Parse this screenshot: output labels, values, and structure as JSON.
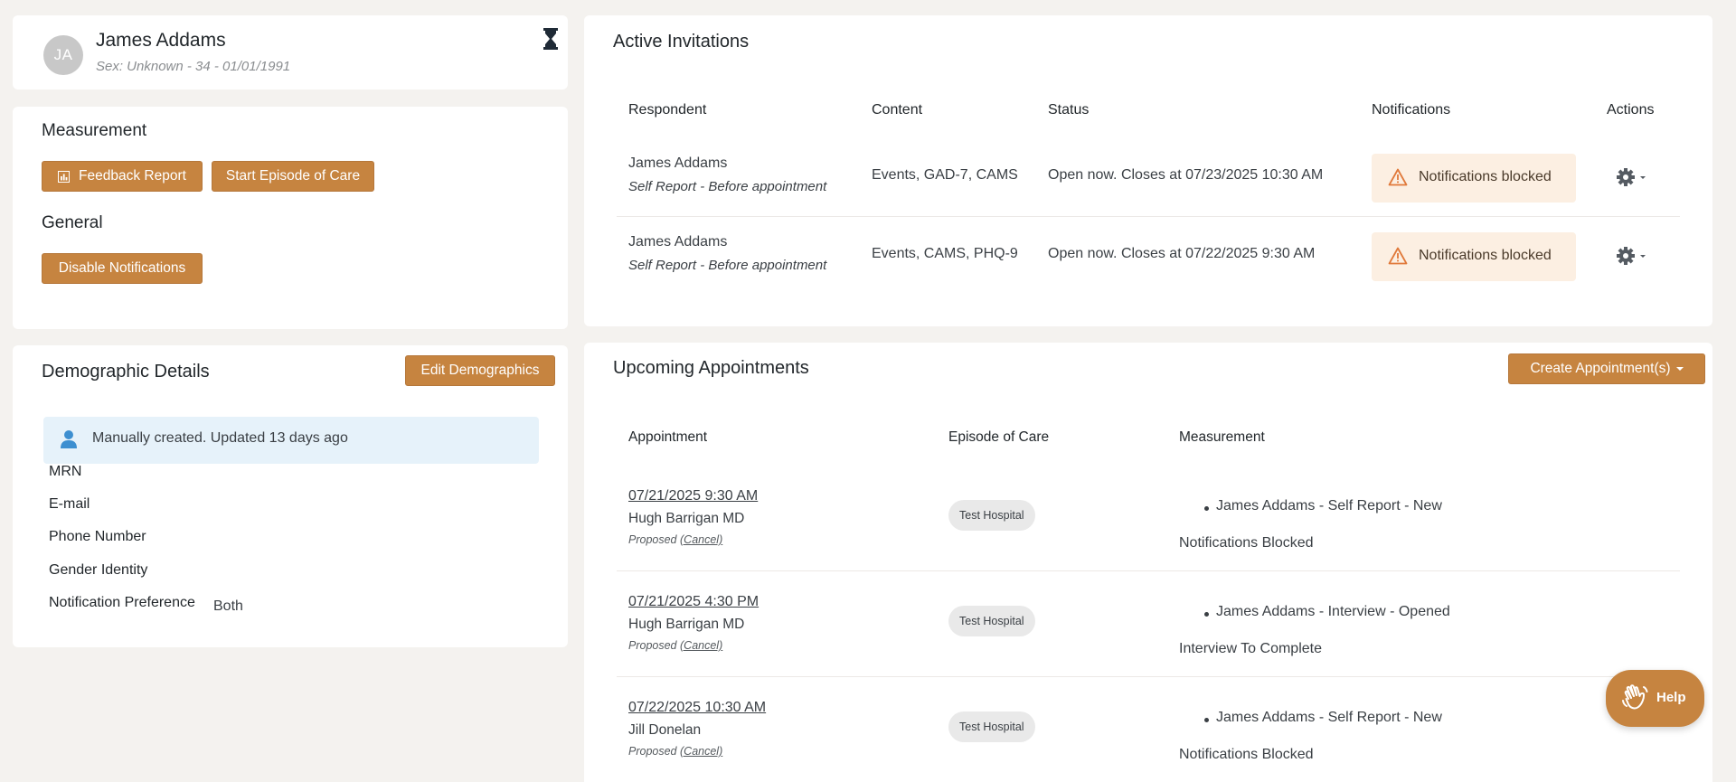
{
  "patient": {
    "initials": "JA",
    "name": "James Addams",
    "meta": "Sex: Unknown - 34 - 01/01/1991"
  },
  "actions_card": {
    "measurement_title": "Measurement",
    "feedback_report_label": "Feedback Report",
    "start_episode_label": "Start Episode of Care",
    "general_title": "General",
    "disable_notifications_label": "Disable Notifications"
  },
  "demographics": {
    "title": "Demographic Details",
    "edit_label": "Edit Demographics",
    "info_text": "Manually created. Updated 13 days ago",
    "fields": [
      {
        "label": "MRN",
        "value": ""
      },
      {
        "label": "E-mail",
        "value": ""
      },
      {
        "label": "Phone Number",
        "value": ""
      },
      {
        "label": "Gender Identity",
        "value": ""
      },
      {
        "label": "Notification Preference",
        "value": "Both"
      }
    ]
  },
  "invitations": {
    "title": "Active Invitations",
    "headers": [
      "Respondent",
      "Content",
      "Status",
      "Notifications",
      "Actions"
    ],
    "rows": [
      {
        "respondent": "James Addams",
        "type": "Self Report - Before appointment",
        "content": "Events, GAD-7, CAMS",
        "status": "Open now. Closes at 07/23/2025 10:30 AM",
        "notifications": "Notifications blocked"
      },
      {
        "respondent": "James Addams",
        "type": "Self Report - Before appointment",
        "content": "Events, CAMS, PHQ-9",
        "status": "Open now. Closes at 07/22/2025 9:30 AM",
        "notifications": "Notifications blocked"
      }
    ]
  },
  "appointments": {
    "title": "Upcoming Appointments",
    "create_label": "Create Appointment(s)",
    "headers": [
      "Appointment",
      "Episode of Care",
      "Measurement"
    ],
    "rows": [
      {
        "datetime": "07/21/2025 9:30 AM",
        "provider": "Hugh Barrigan MD",
        "status": "Proposed",
        "cancel": "(Cancel)",
        "episode": "Test Hospital",
        "measurement": "James Addams - Self Report - New",
        "note": "Notifications Blocked"
      },
      {
        "datetime": "07/21/2025 4:30 PM",
        "provider": "Hugh Barrigan MD",
        "status": "Proposed",
        "cancel": "(Cancel)",
        "episode": "Test Hospital",
        "measurement": "James Addams - Interview - Opened",
        "note": "Interview To Complete"
      },
      {
        "datetime": "07/22/2025 10:30 AM",
        "provider": "Jill Donelan",
        "status": "Proposed",
        "cancel": "(Cancel)",
        "episode": "Test Hospital",
        "measurement": "James Addams - Self Report - New",
        "note": "Notifications Blocked"
      }
    ]
  },
  "help": {
    "label": "Help"
  },
  "colors": {
    "accent": "#c68440",
    "warning_bg": "#fcefe2",
    "warning_icon": "#e0793a",
    "info_bg": "#e6f2fa",
    "info_icon": "#3d8fd0"
  },
  "icons": {
    "hourglass": "hourglass-icon",
    "chart": "bar-chart-icon",
    "person": "person-icon",
    "warning": "warning-triangle-icon",
    "gear": "gear-icon",
    "help": "waving-hand-icon"
  }
}
